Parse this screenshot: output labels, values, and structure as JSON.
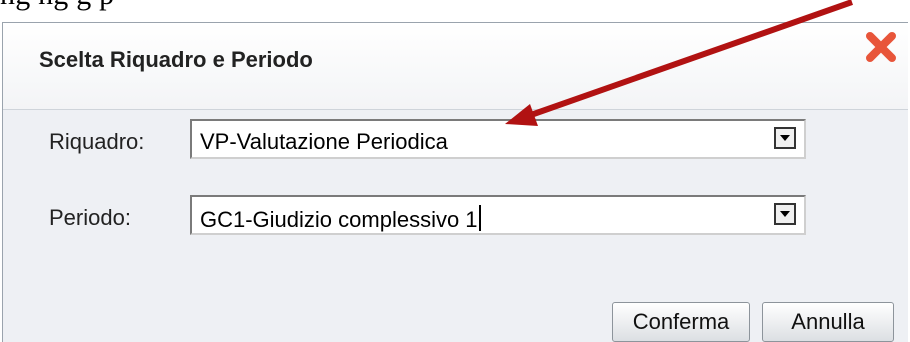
{
  "background_text": "ng                                   ng          g       p",
  "dialog": {
    "title": "Scelta Riquadro e Periodo",
    "close_icon": "close-x-icon",
    "close_color": "#e8553a"
  },
  "fields": {
    "riquadro": {
      "label": "Riquadro:",
      "value": "VP-Valutazione Periodica"
    },
    "periodo": {
      "label": "Periodo:",
      "value": "GC1-Giudizio complessivo 1"
    }
  },
  "buttons": {
    "confirm_label": "Conferma",
    "cancel_label": "Annulla"
  },
  "annotation": {
    "arrow_color": "#b11212"
  }
}
